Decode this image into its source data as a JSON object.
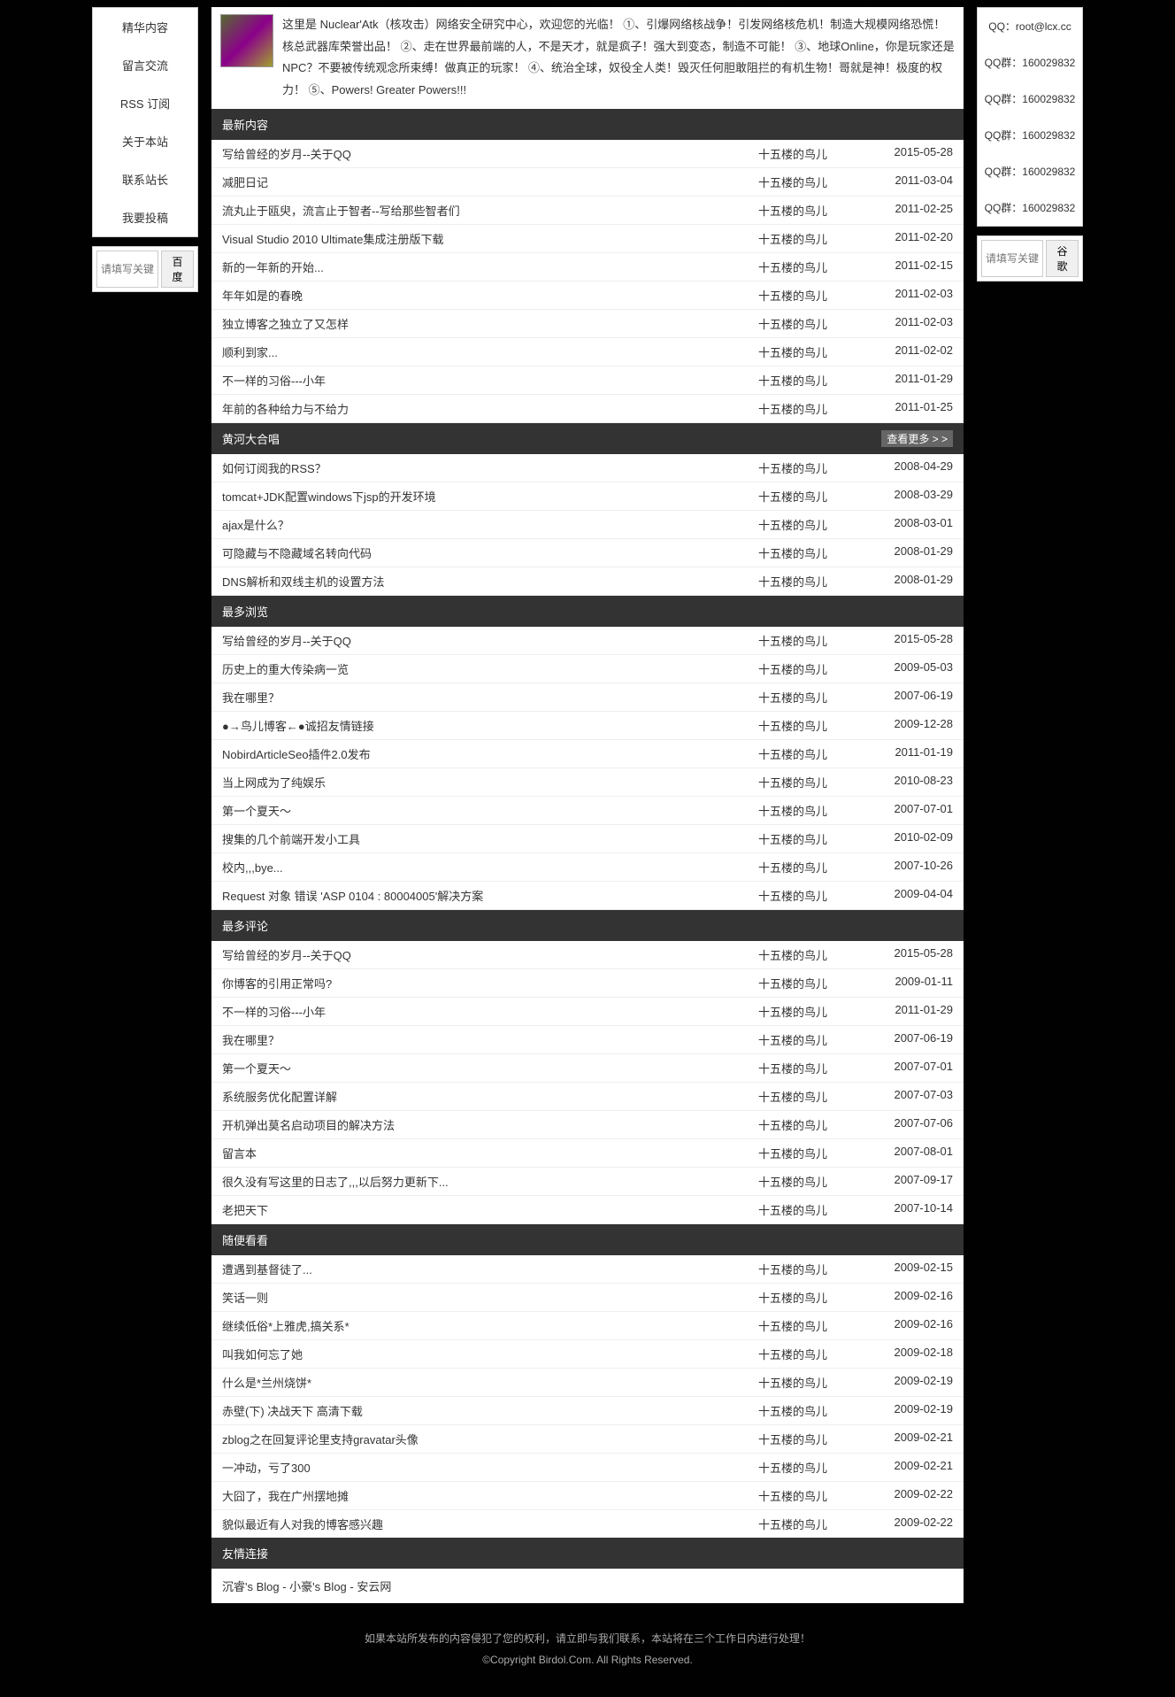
{
  "header": {
    "intro": "这里是 Nuclear'Atk（核攻击）网络安全研究中心，欢迎您的光临！ ①、引爆网络核战争！引发网络核危机！制造大规模网络恐慌！核总武器库荣誉出品！ ②、走在世界最前端的人，不是天才，就是疯子！强大到变态，制造不可能！ ③、地球Online，你是玩家还是NPC？不要被传统观念所束缚！做真正的玩家！ ④、统治全球，奴役全人类！毁灭任何胆敢阻拦的有机生物！哥就是神！极度的权力！ ⑤、Powers! Greater Powers!!!"
  },
  "left_nav": {
    "items": [
      {
        "label": "精华内容"
      },
      {
        "label": "留言交流"
      },
      {
        "label": "RSS 订阅"
      },
      {
        "label": "关于本站"
      },
      {
        "label": "联系站长"
      },
      {
        "label": "我要投稿"
      }
    ],
    "search_placeholder": "请填写关键词...",
    "search_button": "百度"
  },
  "right_panel": {
    "items": [
      {
        "text": "QQ：root@lcx.cc"
      },
      {
        "text": "QQ群：160029832"
      },
      {
        "text": "QQ群：160029832"
      },
      {
        "text": "QQ群：160029832"
      },
      {
        "text": "QQ群：160029832"
      },
      {
        "text": "QQ群：160029832"
      }
    ],
    "search_placeholder": "请填写关键词...",
    "search_button": "谷歌"
  },
  "sections": [
    {
      "title": "最新内容",
      "more": null,
      "rows": [
        {
          "title": "写给曾经的岁月--关于QQ",
          "author": "十五楼的鸟儿",
          "date": "2015-05-28"
        },
        {
          "title": "减肥日记",
          "author": "十五楼的鸟儿",
          "date": "2011-03-04"
        },
        {
          "title": "流丸止于瓯臾，流言止于智者--写给那些智者们",
          "author": "十五楼的鸟儿",
          "date": "2011-02-25"
        },
        {
          "title": "Visual Studio 2010 Ultimate集成注册版下载",
          "author": "十五楼的鸟儿",
          "date": "2011-02-20"
        },
        {
          "title": "新的一年新的开始...",
          "author": "十五楼的鸟儿",
          "date": "2011-02-15"
        },
        {
          "title": "年年如是的春晚",
          "author": "十五楼的鸟儿",
          "date": "2011-02-03"
        },
        {
          "title": "独立博客之独立了又怎样",
          "author": "十五楼的鸟儿",
          "date": "2011-02-03"
        },
        {
          "title": "顺利到家...",
          "author": "十五楼的鸟儿",
          "date": "2011-02-02"
        },
        {
          "title": "不一样的习俗---小年",
          "author": "十五楼的鸟儿",
          "date": "2011-01-29"
        },
        {
          "title": "年前的各种给力与不给力",
          "author": "十五楼的鸟儿",
          "date": "2011-01-25"
        }
      ]
    },
    {
      "title": "黄河大合唱",
      "more": "查看更多 > >",
      "rows": [
        {
          "title": "如何订阅我的RSS？",
          "author": "十五楼的鸟儿",
          "date": "2008-04-29"
        },
        {
          "title": "tomcat+JDK配置windows下jsp的开发环境",
          "author": "十五楼的鸟儿",
          "date": "2008-03-29"
        },
        {
          "title": "ajax是什么？",
          "author": "十五楼的鸟儿",
          "date": "2008-03-01"
        },
        {
          "title": "可隐藏与不隐藏域名转向代码",
          "author": "十五楼的鸟儿",
          "date": "2008-01-29"
        },
        {
          "title": "DNS解析和双线主机的设置方法",
          "author": "十五楼的鸟儿",
          "date": "2008-01-29"
        }
      ]
    },
    {
      "title": "最多浏览",
      "more": null,
      "rows": [
        {
          "title": "写给曾经的岁月--关于QQ",
          "author": "十五楼的鸟儿",
          "date": "2015-05-28"
        },
        {
          "title": "历史上的重大传染病一览",
          "author": "十五楼的鸟儿",
          "date": "2009-05-03"
        },
        {
          "title": "我在哪里？",
          "author": "十五楼的鸟儿",
          "date": "2007-06-19"
        },
        {
          "title": "●→鸟儿博客←●诚招友情链接",
          "author": "十五楼的鸟儿",
          "date": "2009-12-28"
        },
        {
          "title": "NobirdArticleSeo插件2.0发布",
          "author": "十五楼的鸟儿",
          "date": "2011-01-19"
        },
        {
          "title": "当上网成为了纯娱乐",
          "author": "十五楼的鸟儿",
          "date": "2010-08-23"
        },
        {
          "title": "第一个夏天～",
          "author": "十五楼的鸟儿",
          "date": "2007-07-01"
        },
        {
          "title": "搜集的几个前端开发小工具",
          "author": "十五楼的鸟儿",
          "date": "2010-02-09"
        },
        {
          "title": "校内,,,bye...",
          "author": "十五楼的鸟儿",
          "date": "2007-10-26"
        },
        {
          "title": "Request 对象 错误 'ASP 0104 : 80004005'解决方案",
          "author": "十五楼的鸟儿",
          "date": "2009-04-04"
        }
      ]
    },
    {
      "title": "最多评论",
      "more": null,
      "rows": [
        {
          "title": "写给曾经的岁月--关于QQ",
          "author": "十五楼的鸟儿",
          "date": "2015-05-28"
        },
        {
          "title": "你博客的引用正常吗?",
          "author": "十五楼的鸟儿",
          "date": "2009-01-11"
        },
        {
          "title": "不一样的习俗---小年",
          "author": "十五楼的鸟儿",
          "date": "2011-01-29"
        },
        {
          "title": "我在哪里？",
          "author": "十五楼的鸟儿",
          "date": "2007-06-19"
        },
        {
          "title": "第一个夏天～",
          "author": "十五楼的鸟儿",
          "date": "2007-07-01"
        },
        {
          "title": "系统服务优化配置详解",
          "author": "十五楼的鸟儿",
          "date": "2007-07-03"
        },
        {
          "title": "开机弹出莫名启动项目的解决方法",
          "author": "十五楼的鸟儿",
          "date": "2007-07-06"
        },
        {
          "title": "留言本",
          "author": "十五楼的鸟儿",
          "date": "2007-08-01"
        },
        {
          "title": "很久没有写这里的日志了,,,以后努力更新下...",
          "author": "十五楼的鸟儿",
          "date": "2007-09-17"
        },
        {
          "title": "老把天下",
          "author": "十五楼的鸟儿",
          "date": "2007-10-14"
        }
      ]
    },
    {
      "title": "随便看看",
      "more": null,
      "rows": [
        {
          "title": "遭遇到基督徒了...",
          "author": "十五楼的鸟儿",
          "date": "2009-02-15"
        },
        {
          "title": "笑话一则",
          "author": "十五楼的鸟儿",
          "date": "2009-02-16"
        },
        {
          "title": "继续低俗*上雅虎,搞关系*",
          "author": "十五楼的鸟儿",
          "date": "2009-02-16"
        },
        {
          "title": "叫我如何忘了她",
          "author": "十五楼的鸟儿",
          "date": "2009-02-18"
        },
        {
          "title": "什么是*兰州烧饼*",
          "author": "十五楼的鸟儿",
          "date": "2009-02-19"
        },
        {
          "title": "赤壁(下) 决战天下 高清下载",
          "author": "十五楼的鸟儿",
          "date": "2009-02-19"
        },
        {
          "title": "zblog之在回复评论里支持gravatar头像",
          "author": "十五楼的鸟儿",
          "date": "2009-02-21"
        },
        {
          "title": "一冲动，亏了300",
          "author": "十五楼的鸟儿",
          "date": "2009-02-21"
        },
        {
          "title": "大囧了，我在广州摆地摊",
          "author": "十五楼的鸟儿",
          "date": "2009-02-22"
        },
        {
          "title": "貌似最近有人对我的博客感兴趣",
          "author": "十五楼的鸟儿",
          "date": "2009-02-22"
        }
      ]
    }
  ],
  "links_section": {
    "title": "友情连接",
    "content": "沉睿's Blog - 小豪's Blog - 安云网"
  },
  "footer": {
    "line1": "如果本站所发布的内容侵犯了您的权利，请立即与我们联系，本站将在三个工作日内进行处理！",
    "line2": "©Copyright Birdol.Com. All Rights Reserved."
  }
}
